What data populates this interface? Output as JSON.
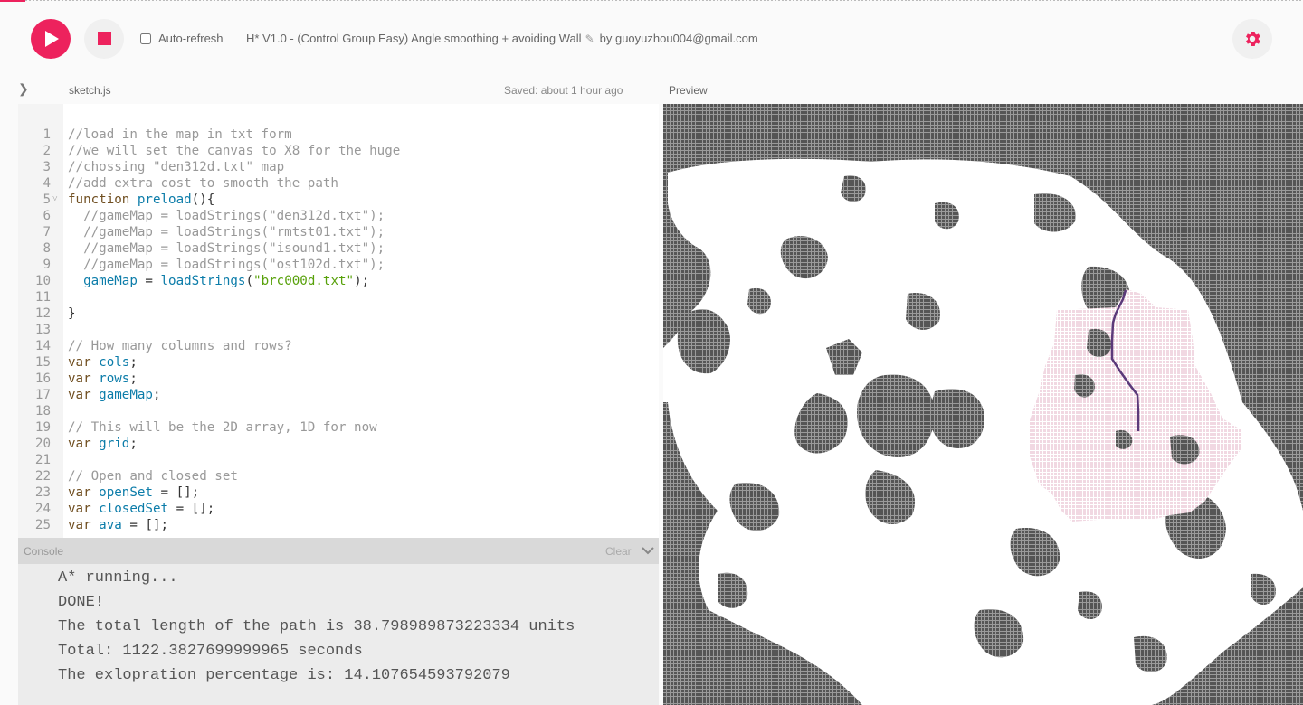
{
  "toolbar": {
    "auto_refresh_label": "Auto-refresh",
    "auto_refresh_checked": false,
    "sketch_name": "H* V1.0 - (Control Group Easy) Angle smoothing + avoiding Wall",
    "author": "by guoyuzhou004@gmail.com"
  },
  "editor": {
    "file_name": "sketch.js",
    "saved_status": "Saved: about 1 hour ago",
    "lines": [
      {
        "n": "1",
        "parts": [
          {
            "c": "comment",
            "t": "//load in the map in txt form"
          }
        ]
      },
      {
        "n": "2",
        "parts": [
          {
            "c": "comment",
            "t": "//we will set the canvas to X8 for the huge"
          }
        ]
      },
      {
        "n": "3",
        "parts": [
          {
            "c": "comment",
            "t": "//chossing \"den312d.txt\" map"
          }
        ]
      },
      {
        "n": "4",
        "parts": [
          {
            "c": "comment",
            "t": "//add extra cost to smooth the path"
          }
        ]
      },
      {
        "n": "5",
        "fold": true,
        "parts": [
          {
            "c": "kw",
            "t": "function "
          },
          {
            "c": "var",
            "t": "preload"
          },
          {
            "c": "punc",
            "t": "(){"
          }
        ]
      },
      {
        "n": "6",
        "parts": [
          {
            "c": "comment",
            "t": "  //gameMap = loadStrings(\"den312d.txt\");"
          }
        ]
      },
      {
        "n": "7",
        "parts": [
          {
            "c": "comment",
            "t": "  //gameMap = loadStrings(\"rmtst01.txt\");"
          }
        ]
      },
      {
        "n": "8",
        "parts": [
          {
            "c": "comment",
            "t": "  //gameMap = loadStrings(\"isound1.txt\");"
          }
        ]
      },
      {
        "n": "9",
        "parts": [
          {
            "c": "comment",
            "t": "  //gameMap = loadStrings(\"ost102d.txt\");"
          }
        ]
      },
      {
        "n": "10",
        "parts": [
          {
            "c": "punc",
            "t": "  "
          },
          {
            "c": "var",
            "t": "gameMap"
          },
          {
            "c": "punc",
            "t": " = "
          },
          {
            "c": "var",
            "t": "loadStrings"
          },
          {
            "c": "punc",
            "t": "("
          },
          {
            "c": "str",
            "t": "\"brc000d.txt\""
          },
          {
            "c": "punc",
            "t": ");"
          }
        ]
      },
      {
        "n": "11",
        "parts": []
      },
      {
        "n": "12",
        "parts": [
          {
            "c": "punc",
            "t": "}"
          }
        ]
      },
      {
        "n": "13",
        "parts": []
      },
      {
        "n": "14",
        "parts": [
          {
            "c": "comment",
            "t": "// How many columns and rows?"
          }
        ]
      },
      {
        "n": "15",
        "parts": [
          {
            "c": "kw",
            "t": "var "
          },
          {
            "c": "var",
            "t": "cols"
          },
          {
            "c": "punc",
            "t": ";"
          }
        ]
      },
      {
        "n": "16",
        "parts": [
          {
            "c": "kw",
            "t": "var "
          },
          {
            "c": "var",
            "t": "rows"
          },
          {
            "c": "punc",
            "t": ";"
          }
        ]
      },
      {
        "n": "17",
        "parts": [
          {
            "c": "kw",
            "t": "var "
          },
          {
            "c": "var",
            "t": "gameMap"
          },
          {
            "c": "punc",
            "t": ";"
          }
        ]
      },
      {
        "n": "18",
        "parts": []
      },
      {
        "n": "19",
        "parts": [
          {
            "c": "comment",
            "t": "// This will be the 2D array, 1D for now"
          }
        ]
      },
      {
        "n": "20",
        "parts": [
          {
            "c": "kw",
            "t": "var "
          },
          {
            "c": "var",
            "t": "grid"
          },
          {
            "c": "punc",
            "t": ";"
          }
        ]
      },
      {
        "n": "21",
        "parts": []
      },
      {
        "n": "22",
        "parts": [
          {
            "c": "comment",
            "t": "// Open and closed set"
          }
        ]
      },
      {
        "n": "23",
        "parts": [
          {
            "c": "kw",
            "t": "var "
          },
          {
            "c": "var",
            "t": "openSet"
          },
          {
            "c": "punc",
            "t": " = [];"
          }
        ]
      },
      {
        "n": "24",
        "parts": [
          {
            "c": "kw",
            "t": "var "
          },
          {
            "c": "var",
            "t": "closedSet"
          },
          {
            "c": "punc",
            "t": " = [];"
          }
        ]
      },
      {
        "n": "25",
        "parts": [
          {
            "c": "kw",
            "t": "var "
          },
          {
            "c": "var",
            "t": "ava"
          },
          {
            "c": "punc",
            "t": " = [];"
          }
        ]
      }
    ]
  },
  "console": {
    "title": "Console",
    "clear_label": "Clear",
    "lines": [
      "A* running...",
      "DONE!",
      "The total length of the path is 38.798989873223334 units",
      "Total: 1122.3827699999965 seconds",
      "The exlopration percentage is: 14.107654593792079"
    ]
  },
  "preview": {
    "label": "Preview",
    "colors": {
      "wall": "#6e6e6e",
      "open": "#ffffff",
      "explored": "#f3dde6",
      "path": "#5b3a7a"
    }
  }
}
